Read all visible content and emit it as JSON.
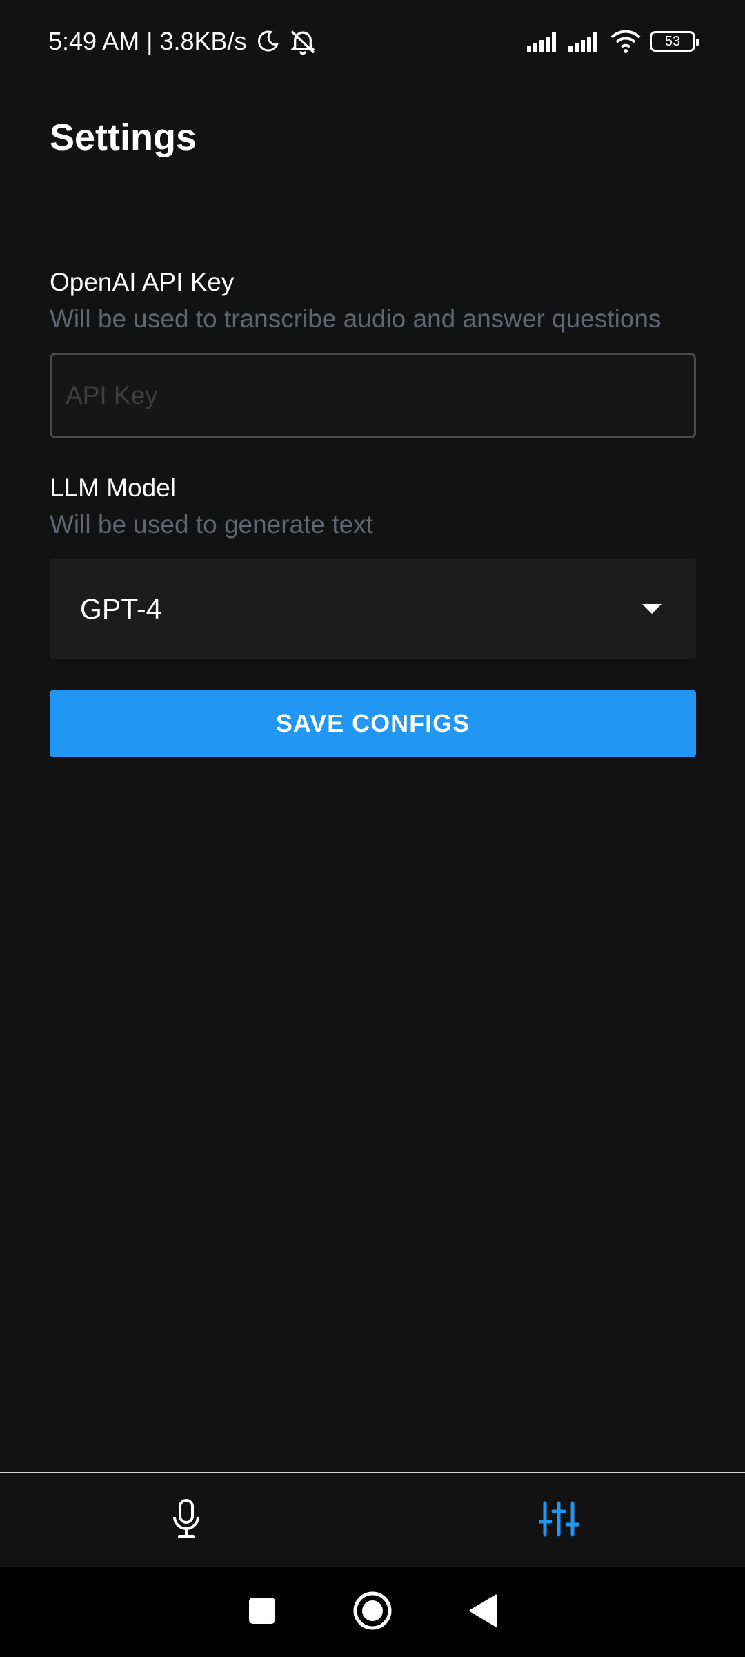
{
  "status_bar": {
    "time_text": "5:49 AM | 3.8KB/s",
    "battery_level": "53"
  },
  "page": {
    "title": "Settings"
  },
  "api_key": {
    "label": "OpenAI API Key",
    "hint": "Will be used to transcribe audio and answer questions",
    "placeholder": "API Key",
    "value": ""
  },
  "llm_model": {
    "label": "LLM Model",
    "hint": "Will be used to generate text",
    "selected": "GPT-4"
  },
  "save_button": {
    "label": "SAVE CONFIGS"
  },
  "bottom_nav": {
    "items": [
      {
        "icon": "microphone-icon",
        "active": false
      },
      {
        "icon": "sliders-icon",
        "active": true
      }
    ]
  },
  "colors": {
    "background": "#121212",
    "accent": "#2196f3",
    "hint_text": "#5f6670"
  }
}
